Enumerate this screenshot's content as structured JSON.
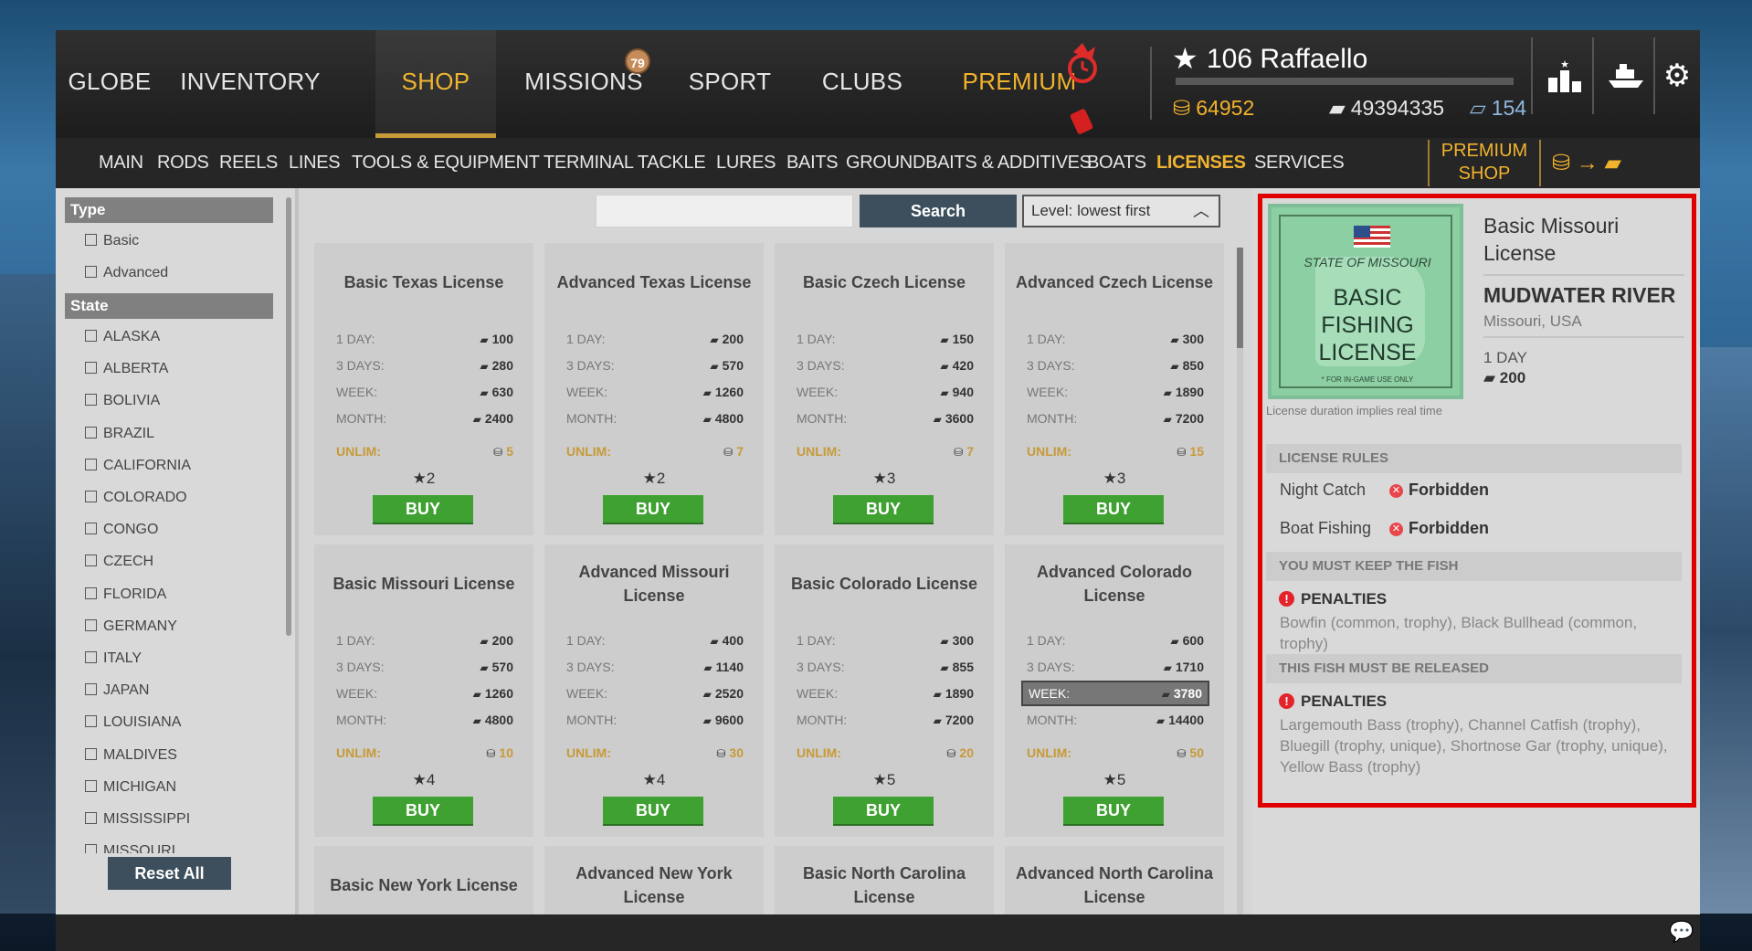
{
  "nav": {
    "tabs": [
      {
        "label": "GLOBE"
      },
      {
        "label": "INVENTORY"
      },
      {
        "label": "SHOP"
      },
      {
        "label": "MISSIONS"
      },
      {
        "label": "SPORT"
      },
      {
        "label": "CLUBS"
      },
      {
        "label": "PREMIUM"
      }
    ],
    "active": "SHOP",
    "missions_badge": "79"
  },
  "player": {
    "level_name": "106 Raffaello",
    "gold": "64952",
    "silver": "49394335",
    "bait_coins": "154"
  },
  "subnav": {
    "items": [
      "MAIN",
      "RODS",
      "REELS",
      "LINES",
      "TOOLS & EQUIPMENT",
      "TERMINAL TACKLE",
      "LURES",
      "BAITS",
      "GROUNDBAITS & ADDITIVES",
      "BOATS",
      "LICENSES",
      "SERVICES"
    ],
    "active": "LICENSES",
    "premium_shop_line1": "PREMIUM",
    "premium_shop_line2": "SHOP",
    "exchange_arrow": "→"
  },
  "filters": {
    "type_header": "Type",
    "types": [
      "Basic",
      "Advanced"
    ],
    "state_header": "State",
    "states": [
      "ALASKA",
      "ALBERTA",
      "BOLIVIA",
      "BRAZIL",
      "CALIFORNIA",
      "COLORADO",
      "CONGO",
      "CZECH",
      "FLORIDA",
      "GERMANY",
      "ITALY",
      "JAPAN",
      "LOUISIANA",
      "MALDIVES",
      "MICHIGAN",
      "MISSISSIPPI",
      "MISSOURI"
    ],
    "reset_label": "Reset All"
  },
  "search": {
    "value": "",
    "button": "Search",
    "sort": "Level: lowest first"
  },
  "price_labels": {
    "day": "1 DAY:",
    "days3": "3 DAYS:",
    "week": "WEEK:",
    "month": "MONTH:",
    "unlim": "UNLIM:"
  },
  "buy_label": "BUY",
  "licenses": [
    {
      "title": "Basic Texas License",
      "day": "100",
      "days3": "280",
      "week": "630",
      "month": "2400",
      "unlim": "5",
      "level": "2"
    },
    {
      "title": "Advanced Texas License",
      "day": "200",
      "days3": "570",
      "week": "1260",
      "month": "4800",
      "unlim": "7",
      "level": "2"
    },
    {
      "title": "Basic Czech License",
      "day": "150",
      "days3": "420",
      "week": "940",
      "month": "3600",
      "unlim": "7",
      "level": "3"
    },
    {
      "title": "Advanced Czech License",
      "day": "300",
      "days3": "850",
      "week": "1890",
      "month": "7200",
      "unlim": "15",
      "level": "3"
    },
    {
      "title": "Basic Missouri License",
      "day": "200",
      "days3": "570",
      "week": "1260",
      "month": "4800",
      "unlim": "10",
      "level": "4"
    },
    {
      "title": "Advanced Missouri License",
      "day": "400",
      "days3": "1140",
      "week": "2520",
      "month": "9600",
      "unlim": "30",
      "level": "4"
    },
    {
      "title": "Basic Colorado License",
      "day": "300",
      "days3": "855",
      "week": "1890",
      "month": "7200",
      "unlim": "20",
      "level": "5"
    },
    {
      "title": "Advanced Colorado License",
      "day": "600",
      "days3": "1710",
      "week": "3780",
      "month": "14400",
      "unlim": "50",
      "level": "5"
    },
    {
      "title": "Basic New York License"
    },
    {
      "title": "Advanced New York License"
    },
    {
      "title": "Basic North Carolina License"
    },
    {
      "title": "Advanced North Carolina License"
    }
  ],
  "detail": {
    "image_state": "STATE OF MISSOURI",
    "image_line1": "BASIC",
    "image_line2": "FISHING",
    "image_line3": "LICENSE",
    "image_footer": "* FOR IN-GAME USE ONLY",
    "duration_note": "License duration implies real time",
    "title": "Basic Missouri License",
    "location": "MUDWATER RIVER",
    "region": "Missouri, USA",
    "duration": "1 DAY",
    "price": "200",
    "rules_header": "LICENSE RULES",
    "rules": [
      {
        "label": "Night Catch",
        "value": "Forbidden"
      },
      {
        "label": "Boat Fishing",
        "value": "Forbidden"
      }
    ],
    "keep_header": "YOU MUST KEEP THE FISH",
    "keep_penalty": "PENALTIES",
    "keep_text": "Bowfin (common, trophy), Black Bullhead (common, trophy)",
    "release_header": "THIS FISH MUST BE RELEASED",
    "release_penalty": "PENALTIES",
    "release_text": "Largemouth Bass (trophy), Channel Catfish (trophy), Bluegill (trophy, unique), Shortnose Gar (trophy, unique), Yellow Bass (trophy)"
  },
  "colors": {
    "accent": "#f0b431",
    "buy": "#3fa132",
    "highlight_frame": "#e00000"
  }
}
